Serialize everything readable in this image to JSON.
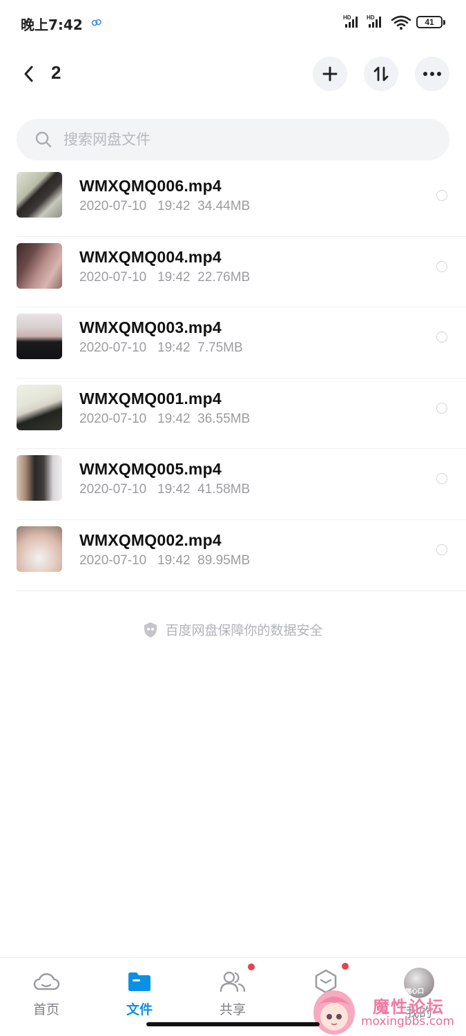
{
  "status_bar": {
    "time": "晚上7:42",
    "battery": "41",
    "signal_label_1": "HD",
    "signal_label_2": "HD"
  },
  "header": {
    "title": "2",
    "add_icon": "plus-icon",
    "sort_icon": "sort-icon",
    "more_icon": "more-icon"
  },
  "search": {
    "placeholder": "搜索网盘文件"
  },
  "files": [
    {
      "name": "WMXQMQ006.mp4",
      "date": "2020-07-10",
      "time": "19:42",
      "size": "34.44MB"
    },
    {
      "name": "WMXQMQ004.mp4",
      "date": "2020-07-10",
      "time": "19:42",
      "size": "22.76MB"
    },
    {
      "name": "WMXQMQ003.mp4",
      "date": "2020-07-10",
      "time": "19:42",
      "size": "7.75MB"
    },
    {
      "name": "WMXQMQ001.mp4",
      "date": "2020-07-10",
      "time": "19:42",
      "size": "36.55MB"
    },
    {
      "name": "WMXQMQ005.mp4",
      "date": "2020-07-10",
      "time": "19:42",
      "size": "41.58MB"
    },
    {
      "name": "WMXQMQ002.mp4",
      "date": "2020-07-10",
      "time": "19:42",
      "size": "89.95MB"
    }
  ],
  "safety_note": "百度网盘保障你的数据安全",
  "bottom_nav": {
    "items": [
      {
        "label": "首页",
        "icon": "cloud-icon"
      },
      {
        "label": "文件",
        "icon": "folder-icon"
      },
      {
        "label": "共享",
        "icon": "people-icon"
      },
      {
        "label": "",
        "icon": "box-icon"
      },
      {
        "label": "我的",
        "icon": "avatar"
      }
    ],
    "avatar_text": "揣心口"
  },
  "watermark": {
    "title": "魔性论坛",
    "url": "moxingbbs.com"
  },
  "colors": {
    "accent": "#0a91e6",
    "badge": "#e8434b",
    "muted_text": "#9a9ca1"
  }
}
